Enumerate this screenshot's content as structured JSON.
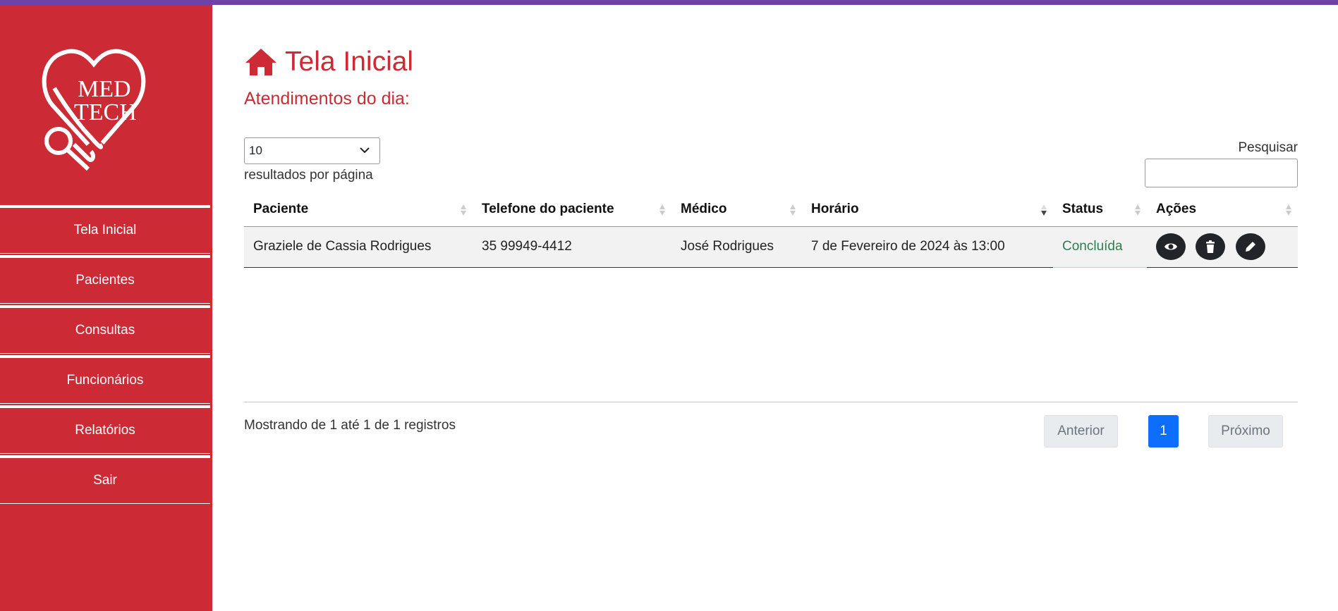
{
  "app": {
    "logo_line1": "MED",
    "logo_line2": "TECH"
  },
  "sidebar": {
    "items": [
      {
        "label": "Tela Inicial"
      },
      {
        "label": "Pacientes"
      },
      {
        "label": "Consultas"
      },
      {
        "label": "Funcionários"
      },
      {
        "label": "Relatórios"
      },
      {
        "label": "Sair"
      }
    ]
  },
  "main": {
    "title": "Tela Inicial",
    "subtitle": "Atendimentos do dia:",
    "length_value": "10",
    "length_label": "resultados por página",
    "search_label": "Pesquisar",
    "search_value": "",
    "table": {
      "columns": [
        "Paciente",
        "Telefone do paciente",
        "Médico",
        "Horário",
        "Status",
        "Ações"
      ],
      "rows": [
        {
          "paciente": "Graziele de Cassia Rodrigues",
          "telefone": "35 99949-4412",
          "medico": "José Rodrigues",
          "horario": "7 de Fevereiro de 2024 às 13:00",
          "status": "Concluída"
        }
      ]
    },
    "info": "Mostrando de 1 até 1 de 1 registros",
    "pagination": {
      "prev": "Anterior",
      "page": "1",
      "next": "Próximo"
    }
  },
  "colors": {
    "brand": "#cc2a34",
    "topbar": "#6f42a8",
    "status_ok": "#2e7d4f",
    "page_active": "#0d6efd"
  },
  "icons": [
    "home-icon",
    "chevron-down-icon",
    "eye-icon",
    "trash-icon",
    "pencil-icon",
    "sort-icon"
  ]
}
